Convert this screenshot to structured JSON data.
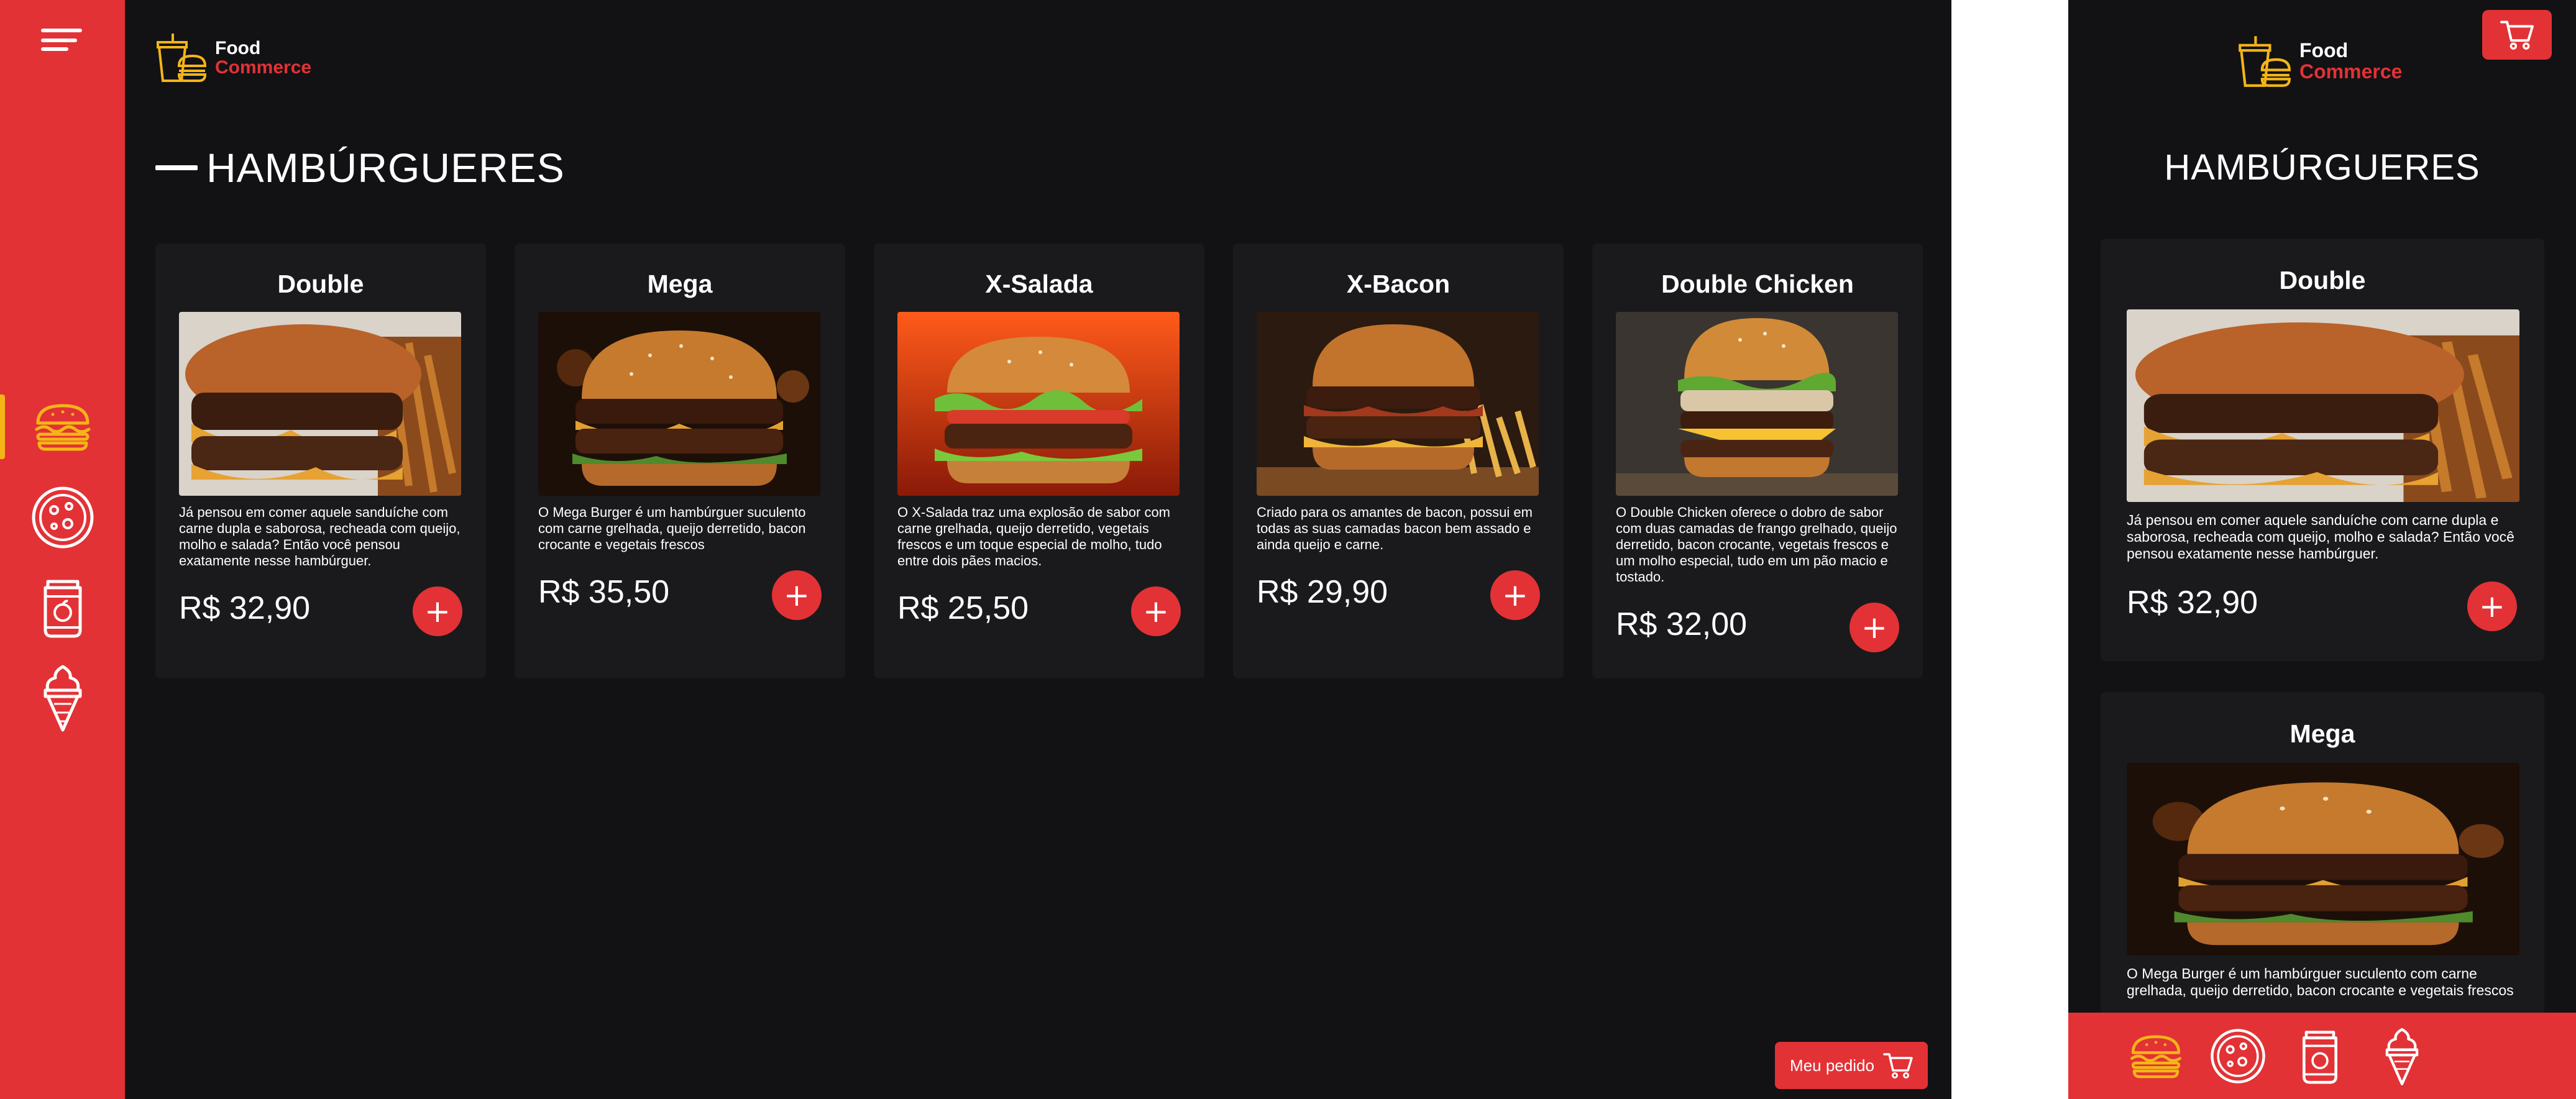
{
  "brand": {
    "line1": "Food",
    "line2": "Commerce"
  },
  "sidebar": {
    "items": [
      {
        "icon": "burger-icon",
        "label": "Hambúrgueres",
        "active": true
      },
      {
        "icon": "pizza-icon",
        "label": "Pizzas",
        "active": false
      },
      {
        "icon": "drink-icon",
        "label": "Bebidas",
        "active": false
      },
      {
        "icon": "ice-cream-icon",
        "label": "Sobremesas",
        "active": false
      }
    ]
  },
  "section": {
    "title": "HAMBÚRGUERES"
  },
  "products": [
    {
      "name": "Double",
      "description": "Já pensou em comer aquele sanduíche com carne dupla e saborosa, recheada com queijo, molho e salada? Então você pensou exatamente nesse hambúrguer.",
      "price": "R$ 32,90",
      "add_label": "+"
    },
    {
      "name": "Mega",
      "description": "O Mega Burger é um hambúrguer suculento com carne grelhada, queijo derretido, bacon crocante e vegetais frescos",
      "price": "R$ 35,50",
      "add_label": "+"
    },
    {
      "name": "X-Salada",
      "description": "O X-Salada traz uma explosão de sabor com carne grelhada, queijo derretido, vegetais frescos e um toque especial de molho, tudo entre dois pães macios.",
      "price": "R$ 25,50",
      "add_label": "+"
    },
    {
      "name": "X-Bacon",
      "description": "Criado para os amantes de bacon, possui em todas as suas camadas bacon bem assado e ainda queijo e carne.",
      "price": "R$ 29,90",
      "add_label": "+"
    },
    {
      "name": "Double Chicken",
      "description": "O Double Chicken oferece o dobro de sabor com duas camadas de frango grelhado, queijo derretido, bacon crocante, vegetais frescos e um molho especial, tudo em um pão macio e tostado.",
      "price": "R$ 32,00",
      "add_label": "+"
    }
  ],
  "order_button": {
    "label": "Meu pedido"
  },
  "colors": {
    "brand_red": "#e23236",
    "accent_yellow": "#f5b517",
    "background": "#121214",
    "card": "#1a1a1c"
  }
}
